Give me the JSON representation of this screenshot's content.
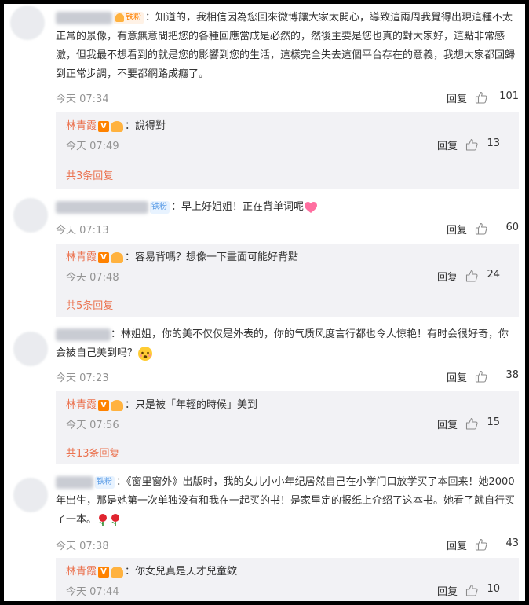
{
  "ui": {
    "reply_label": "回复",
    "author_name": "林青霞",
    "v_mark": "V"
  },
  "comments": [
    {
      "badge": "铁粉",
      "text": "知道的，我相信因為您回來微博讓大家太開心，導致這兩周我覺得出現這種不太正常的景像，有意無意間把您的各種回應當成是必然的，然後主要是您也真的對大家好，這點非常感激，但我最不想看到的就是您的影響到您的生活，這樣完全失去這個平台存在的意義，我想大家都回歸到正常步調，不要都網路成癮了。",
      "time": "今天 07:34",
      "likes": "101",
      "reply": {
        "text": "說得對",
        "time": "今天 07:49",
        "likes": "13"
      },
      "more": "共3条回复"
    },
    {
      "badge": "铁粉",
      "text": "早上好姐姐！正在背单词呢",
      "time": "今天 07:13",
      "likes": "60",
      "reply": {
        "text": "容易背嗎？想像一下畫面可能好背點",
        "time": "今天 07:48",
        "likes": "24"
      },
      "more": "共5条回复"
    },
    {
      "badge": "",
      "text": "林姐姐，你的美不仅仅是外表的，你的气质风度言行都也令人惊艳！有时会很好奇，你会被自己美到吗？",
      "time": "今天 07:23",
      "likes": "38",
      "reply": {
        "text": "只是被「年輕的時候」美到",
        "time": "今天 07:56",
        "likes": "15"
      },
      "more": "共13条回复"
    },
    {
      "badge": "铁粉",
      "text": "《窗里窗外》出版时，我的女儿小小年纪居然自己在小学门口放学买了本回来！她2000年出生，那是她第一次单独没有和我在一起买的书！是家里定的报纸上介绍了这本书。她看了就自行买了一本。",
      "time": "今天 07:38",
      "likes": "43",
      "reply": {
        "text": "你女兒真是天才兒童欸",
        "time": "今天 07:44",
        "likes": "10"
      },
      "more": ""
    }
  ]
}
